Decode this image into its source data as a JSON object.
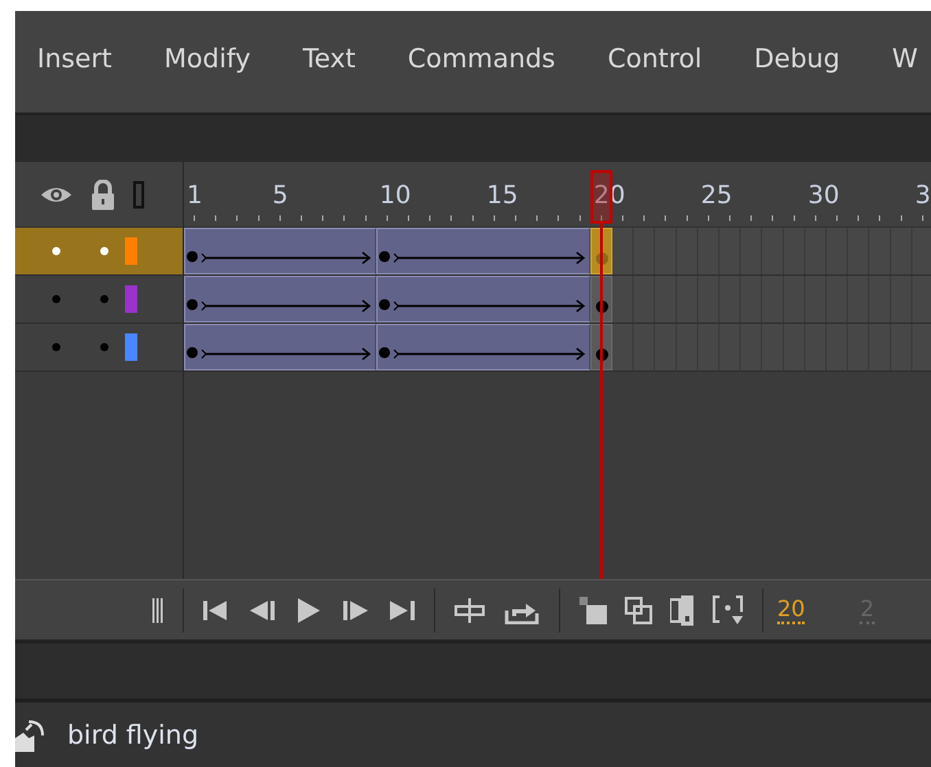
{
  "menu": [
    {
      "label": "Insert"
    },
    {
      "label": "Modify"
    },
    {
      "label": "Text"
    },
    {
      "label": "Commands"
    },
    {
      "label": "Control"
    },
    {
      "label": "Debug"
    },
    {
      "label": "W"
    }
  ],
  "timeline": {
    "ruler_labels": [
      "1",
      "5",
      "10",
      "15",
      "20",
      "25",
      "30",
      "3"
    ],
    "layers": [
      {
        "selected": true,
        "color": "#ff8000",
        "segments": [
          {
            "kind": "tween"
          },
          {
            "kind": "tween"
          },
          {
            "kind": "keyframe"
          }
        ]
      },
      {
        "selected": false,
        "color": "#9933cc",
        "segments": [
          {
            "kind": "tween"
          },
          {
            "kind": "tween"
          },
          {
            "kind": "keyframe"
          }
        ]
      },
      {
        "selected": false,
        "color": "#4a86ff",
        "segments": [
          {
            "kind": "tween"
          },
          {
            "kind": "tween"
          },
          {
            "kind": "keyframe"
          }
        ]
      }
    ]
  },
  "controls": {
    "current_frame": "20",
    "frame_rate": "2"
  },
  "status_bar": {
    "label": "bird flying"
  }
}
